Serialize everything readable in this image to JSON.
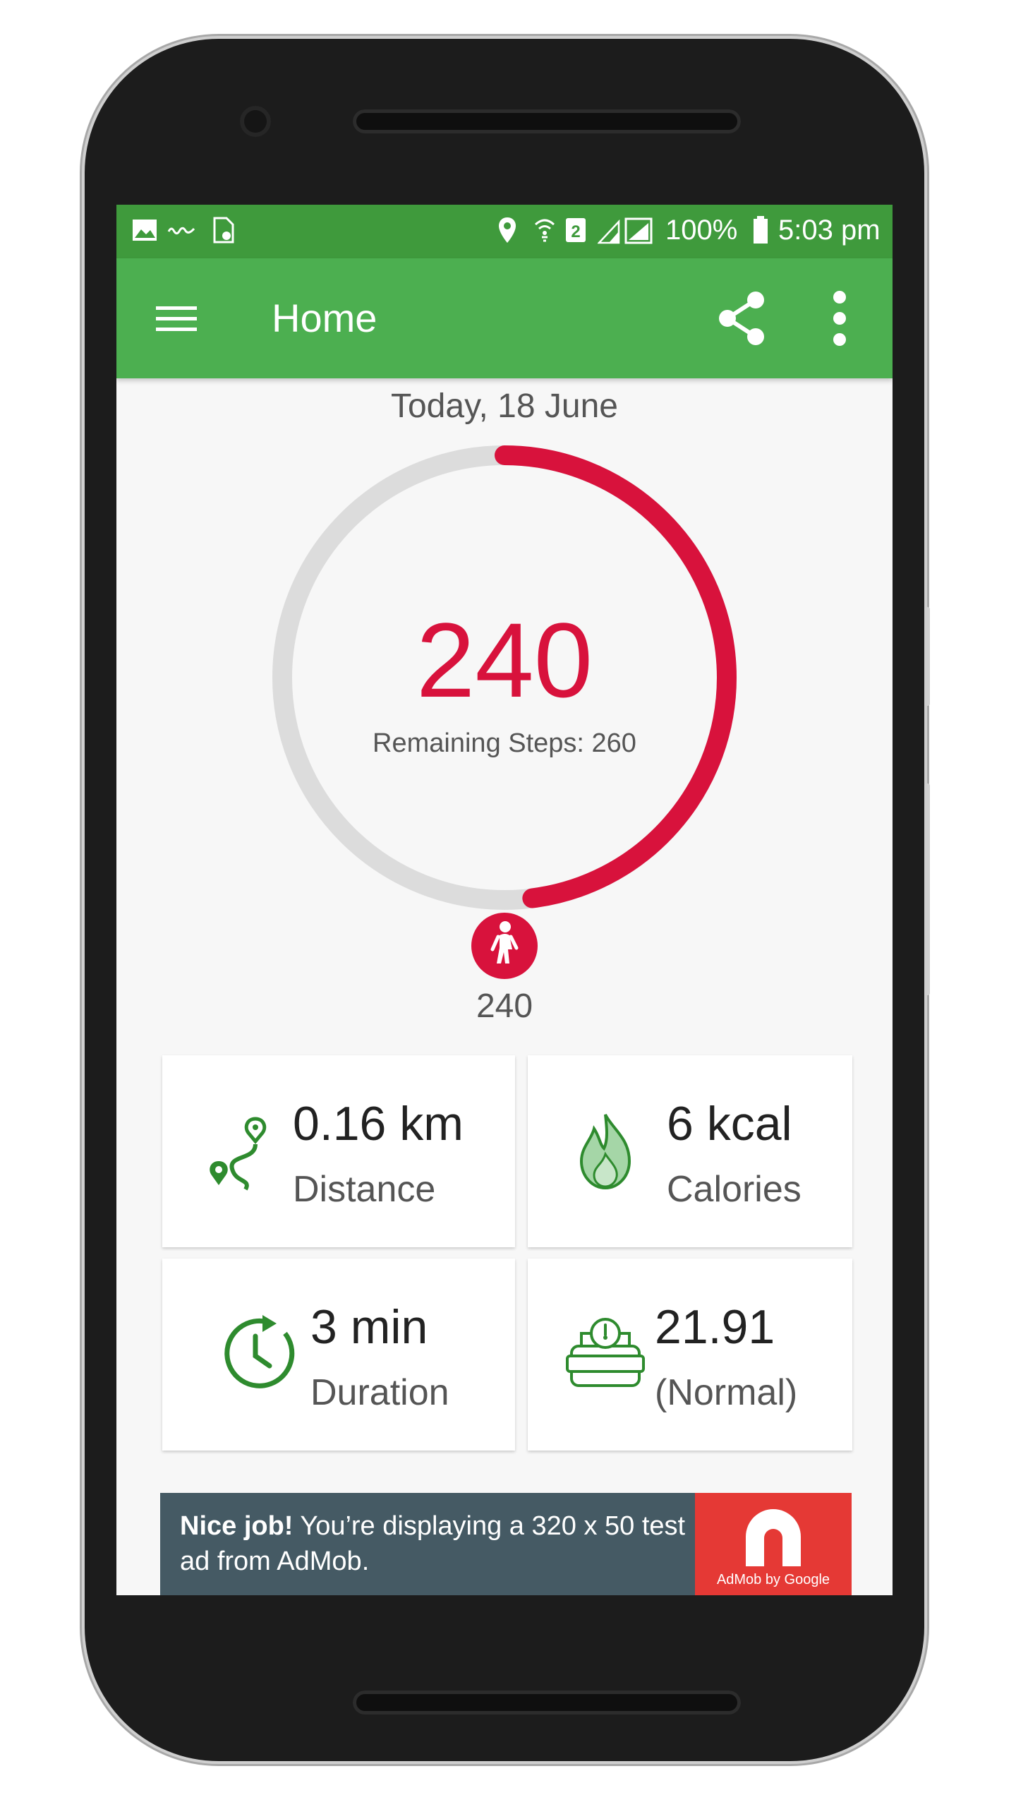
{
  "status_bar": {
    "battery": "100%",
    "time": "5:03 pm",
    "icons": [
      "image-icon",
      "voicemail-icon",
      "sim-icon",
      "location-icon",
      "wifi-icon",
      "signal-icon",
      "battery-icon"
    ]
  },
  "app_bar": {
    "title": "Home",
    "icons": [
      "menu-icon",
      "share-icon",
      "more-vert-icon"
    ]
  },
  "main": {
    "date": "Today, 18 June",
    "steps": "240",
    "remaining": "Remaining Steps: 260",
    "progress": 0.48,
    "walk_steps": "240"
  },
  "stats": [
    {
      "value": "0.16 km",
      "label": "Distance",
      "icon": "route-icon"
    },
    {
      "value": "6 kcal",
      "label": "Calories",
      "icon": "flame-icon"
    },
    {
      "value": "3 min",
      "label": "Duration",
      "icon": "timer-icon"
    },
    {
      "value": "21.91",
      "label": "(Normal)",
      "icon": "weight-scale-icon"
    }
  ],
  "ad": {
    "bold": "Nice job!",
    "text": " You’re displaying a 320 x 50 test ad from AdMob.",
    "logo_text": "AdMob by Google"
  },
  "colors": {
    "status_bar": "#3f9a3c",
    "app_bar": "#4caf50",
    "accent_red": "#d8123c",
    "ring_track": "#dcdcdc",
    "icon_green": "#2e8b2e",
    "ad_bg": "#455a64",
    "ad_logo": "#e53935"
  }
}
